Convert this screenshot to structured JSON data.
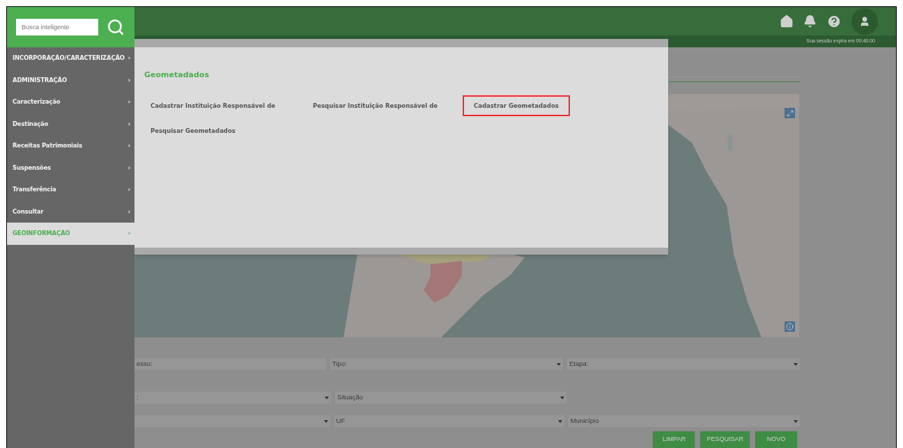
{
  "search": {
    "placeholder": "Busca inteligente"
  },
  "sidebar": {
    "items": [
      {
        "label": "INCORPORAÇÃO/CARACTERIZAÇÃO",
        "chevron": "›",
        "selected": false
      },
      {
        "label": "ADMINISTRAÇÃO",
        "chevron": "›",
        "selected": false
      },
      {
        "label": "Caracterização",
        "chevron": "›",
        "selected": false
      },
      {
        "label": "Destinação",
        "chevron": "›",
        "selected": false
      },
      {
        "label": "Receitas Patrimoniais",
        "chevron": "›",
        "selected": false
      },
      {
        "label": "Suspensões",
        "chevron": "›",
        "selected": false
      },
      {
        "label": "Transferência",
        "chevron": "›",
        "selected": false
      },
      {
        "label": "Consultar",
        "chevron": "›",
        "selected": false
      },
      {
        "label": "GEOINFORMAÇÃO",
        "chevron": "›",
        "selected": true
      }
    ]
  },
  "header": {
    "session": "Sua sessão expira em 00:40:00"
  },
  "mega_menu": {
    "title": "Geometadados",
    "links": [
      {
        "label": "Cadastrar Instituição Responsável de",
        "highlighted": false
      },
      {
        "label": "Pesquisar Instituição Responsável de",
        "highlighted": false
      },
      {
        "label": "Cadastrar Geometadados",
        "highlighted": true
      },
      {
        "label": "Pesquisar Geometadados",
        "highlighted": false
      }
    ]
  },
  "map": {
    "kind": "picture"
  },
  "filters": {
    "rows": [
      [
        {
          "label": "esso:",
          "dropdown": false
        },
        {
          "label": "Tipo:",
          "dropdown": true
        },
        {
          "label": "Etapa:",
          "dropdown": true
        }
      ],
      [
        {
          "label": ":",
          "dropdown": true
        },
        {
          "label": "Situação",
          "dropdown": true
        }
      ],
      [
        {
          "dropdown": true
        },
        {
          "label": "UF",
          "dropdown": true
        },
        {
          "label": "Município",
          "dropdown": true
        }
      ]
    ]
  },
  "buttons": [
    "LIMPAR",
    "PESQUISAR",
    "NOVO"
  ]
}
